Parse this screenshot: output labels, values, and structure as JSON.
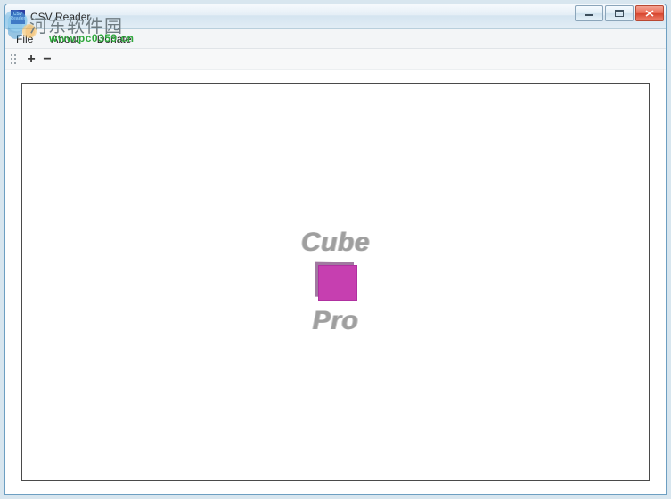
{
  "window": {
    "title": "CSV Reader",
    "app_icon_text": "CSV Reader"
  },
  "menu": {
    "file": "File",
    "about": "About",
    "donate": "Donate"
  },
  "toolbar": {
    "plus_label": "+",
    "minus_label": "−"
  },
  "logo": {
    "top": "Cube",
    "bottom": "Pro"
  },
  "watermark": {
    "text": "河东软件园",
    "url": "www.pc0359.cn"
  }
}
